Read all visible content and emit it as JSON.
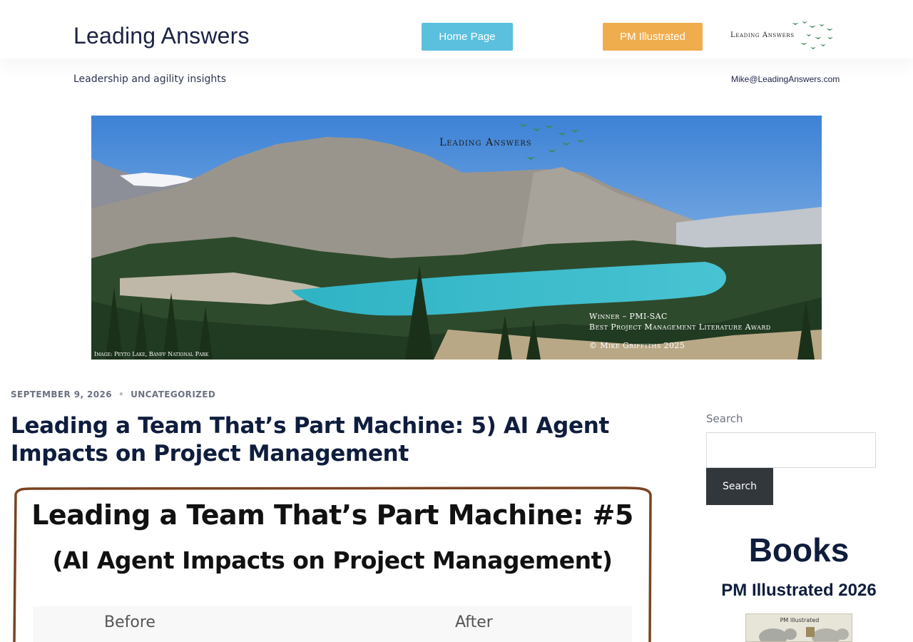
{
  "header": {
    "site_title": "Leading Answers",
    "home_button": "Home Page",
    "pm_button": "PM Illustrated",
    "logo_text": "Leading Answers",
    "tagline": "Leadership and agility insights",
    "email": "Mike@LeadingAnswers.com"
  },
  "banner": {
    "logo_text": "Leading Answers",
    "award_line1": "Winner – PMI-SAC",
    "award_line2": "Best Project Management Literature Award",
    "copyright": "© Mike Griffiths 2025",
    "image_caption": "Image: Peyto Lake, Banff National Park"
  },
  "post": {
    "date": "September 9, 2026",
    "category": "Uncategorized",
    "title": "Leading a Team That’s Part Machine: 5) AI Agent Impacts on Project Management",
    "feature_title_line1": "Leading a Team That’s Part Machine: #5",
    "feature_title_line2": "(AI Agent Impacts on Project Management)",
    "feature_before": "Before",
    "feature_after": "After"
  },
  "sidebar": {
    "search_label": "Search",
    "search_placeholder": "",
    "search_button": "Search",
    "books_heading": "Books",
    "book_title": "PM Illustrated 2026",
    "book_cover_text": "PM Illustrated"
  },
  "colors": {
    "home_button": "#5bc0de",
    "pm_button": "#f0ad4e",
    "heading_navy": "#0f1d3d",
    "search_button": "#32373c"
  }
}
